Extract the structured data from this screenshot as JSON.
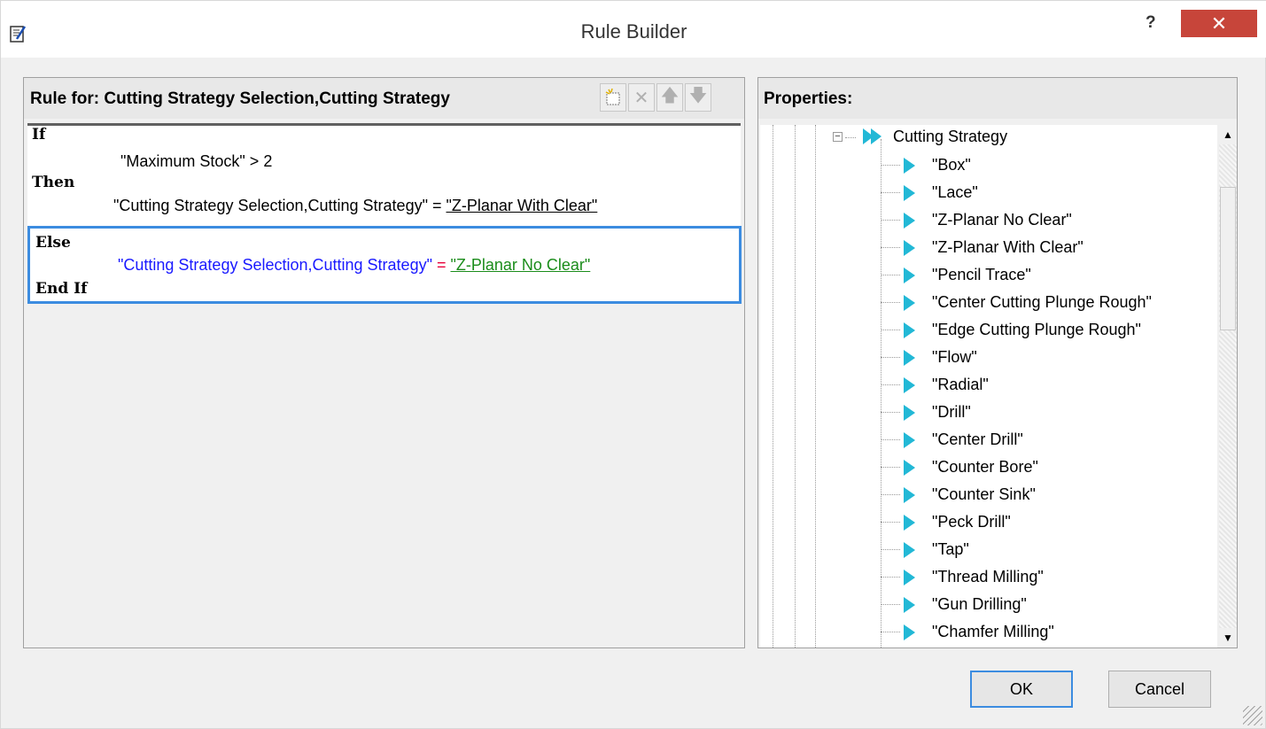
{
  "window": {
    "title": "Rule Builder",
    "help_label": "?",
    "close_label": "✕"
  },
  "left_panel": {
    "title": "Rule for: Cutting Strategy Selection,Cutting Strategy",
    "toolbar": {
      "new_icon": "new-rule-icon",
      "delete_label": "✕",
      "up_label": "🡅",
      "down_label": "🡇"
    }
  },
  "rule": {
    "if_kw": "If",
    "condition": "\"Maximum Stock\" > 2",
    "then_kw": "Then",
    "then_lhs": "\"Cutting Strategy Selection,Cutting Strategy\"",
    "then_eq": " = ",
    "then_value": "\"Z-Planar With Clear\"",
    "else_kw": "Else",
    "else_lhs": "\"Cutting Strategy Selection,Cutting Strategy\"",
    "else_eq": " = ",
    "else_value": "\"Z-Planar No Clear\"",
    "endif_kw": "End If"
  },
  "right_panel": {
    "title": "Properties:",
    "expander_label": "−",
    "root_label": "Cutting Strategy",
    "items": [
      "\"Box\"",
      "\"Lace\"",
      "\"Z-Planar No Clear\"",
      "\"Z-Planar With Clear\"",
      "\"Pencil Trace\"",
      "\"Center Cutting Plunge Rough\"",
      "\"Edge Cutting Plunge Rough\"",
      "\"Flow\"",
      "\"Radial\"",
      "\"Drill\"",
      "\"Center Drill\"",
      "\"Counter Bore\"",
      "\"Counter Sink\"",
      "\"Peck Drill\"",
      "\"Tap\"",
      "\"Thread Milling\"",
      "\"Gun Drilling\"",
      "\"Chamfer Milling\""
    ],
    "scroll_up_label": "▲",
    "scroll_down_label": "▼"
  },
  "buttons": {
    "ok": "OK",
    "cancel": "Cancel"
  },
  "colors": {
    "accent": "#3c8ce0",
    "close": "#c7453a",
    "tree_icon": "#22b8d6",
    "keyword_blue": "#1a1aff",
    "equals_red": "#e8003a",
    "value_green": "#1a8c1a"
  }
}
